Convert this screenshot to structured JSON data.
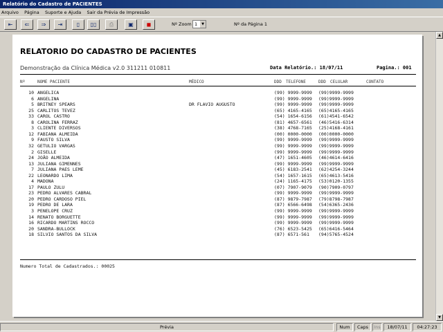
{
  "window": {
    "title": "Relatório do Cadastro de PACIENTES"
  },
  "menu": [
    "Arquivo",
    "Página",
    "Suporte e Ajuda",
    "Sair da Prévia de Impressão"
  ],
  "toolbar": {
    "buttons": [
      {
        "name": "first-page-icon",
        "glyph": "⇤"
      },
      {
        "name": "prev-page-icon",
        "glyph": "⇐"
      },
      {
        "name": "next-page-icon",
        "glyph": "⇒"
      },
      {
        "name": "last-page-icon",
        "glyph": "⇥"
      },
      {
        "name": "single-page-icon",
        "glyph": "▯"
      },
      {
        "name": "two-pages-icon",
        "glyph": "▯▯"
      },
      {
        "name": "printer-icon",
        "glyph": "⎙"
      },
      {
        "name": "setup-icon",
        "glyph": "▣"
      },
      {
        "name": "stop-icon",
        "glyph": "◼"
      }
    ],
    "zoom_label": "Nº Zoom",
    "zoom_value": "1",
    "page_label": "Nº da Página 1"
  },
  "report": {
    "title": "RELATORIO DO CADASTRO DE PACIENTES",
    "subtitle": "Demonstração da Clínica Médica v2.0 311211 010811",
    "date": "Data Relatório.: 18/07/11",
    "page": "Pagina.: 001",
    "headers": {
      "num": "Nº",
      "name": "NOME PACIENTE",
      "doctor": "MÉDICO",
      "ddd1": "DDD",
      "phone": "TELEFONE",
      "ddd2": "DDD",
      "cell": "CELULAR",
      "contact": "CONTATO"
    },
    "rows": [
      {
        "n": "10",
        "name": "ANGELICA",
        "doc": "",
        "ph": "(99) 9999-9999",
        "cel": "(99)9999-9999"
      },
      {
        "n": "6",
        "name": "ANGELINA",
        "doc": "",
        "ph": "(99) 9999-9999",
        "cel": "(99)9999-9999"
      },
      {
        "n": "5",
        "name": "BRITNEY SPEARS",
        "doc": "DR FLAVIO AUGUSTO",
        "ph": "(99) 9999-9999",
        "cel": "(99)9999-9999"
      },
      {
        "n": "25",
        "name": "CARLITOS TEVEZ",
        "doc": "",
        "ph": "(65) 4165-4165",
        "cel": "(65)4165-4165"
      },
      {
        "n": "33",
        "name": "CAROL CASTRO",
        "doc": "",
        "ph": "(54) 1654-6156",
        "cel": "(61)4541-6542"
      },
      {
        "n": "8",
        "name": "CAROLINA FERRAZ",
        "doc": "",
        "ph": "(81) 4657-6561",
        "cel": "(46)5416-6314"
      },
      {
        "n": "3",
        "name": "CLIENTE DIVERSOS",
        "doc": "",
        "ph": "(38) 4768-7165",
        "cel": "(25)4168-4161"
      },
      {
        "n": "12",
        "name": "FABIANA ALMEIDA",
        "doc": "",
        "ph": "(00) 0000-0000",
        "cel": "(00)0000-0000"
      },
      {
        "n": "9",
        "name": "FAUSTO SILVA",
        "doc": "",
        "ph": "(99) 9999-9999",
        "cel": "(99)9999-9999"
      },
      {
        "n": "32",
        "name": "GETULIO VARGAS",
        "doc": "",
        "ph": "(99) 9999-9999",
        "cel": "(99)9999-9999"
      },
      {
        "n": "2",
        "name": "GISELLE",
        "doc": "",
        "ph": "(99) 9999-9999",
        "cel": "(99)9999-9999"
      },
      {
        "n": "24",
        "name": "JOÃO ALMEIDA",
        "doc": "",
        "ph": "(47) 1651-4605",
        "cel": "(46)4614-6416"
      },
      {
        "n": "13",
        "name": "JULIANA GIMENNES",
        "doc": "",
        "ph": "(99) 9999-9999",
        "cel": "(99)9999-9999"
      },
      {
        "n": "7",
        "name": "JULIANA PAES LEME",
        "doc": "",
        "ph": "(45) 6183-2541",
        "cel": "(62)4254-3244"
      },
      {
        "n": "22",
        "name": "LEONARDO LIMA",
        "doc": "",
        "ph": "(54) 1657-1615",
        "cel": "(65)4613-5416"
      },
      {
        "n": "4",
        "name": "MADONA",
        "doc": "",
        "ph": "(24) 1165-4175",
        "cel": "(53)0120-1355"
      },
      {
        "n": "17",
        "name": "PAULO ZULU",
        "doc": "",
        "ph": "(07) 7907-9079",
        "cel": "(90)7909-0797"
      },
      {
        "n": "23",
        "name": "PEDRO ALVARES CABRAL",
        "doc": "",
        "ph": "(99) 9999-9999",
        "cel": "(99)9999-9999"
      },
      {
        "n": "20",
        "name": "PEDRO CARDOSO PIEL",
        "doc": "",
        "ph": "(87) 9879-7987",
        "cel": "(79)8798-7987"
      },
      {
        "n": "19",
        "name": "PEDRO DE LARA",
        "doc": "",
        "ph": "(87) 6566-6498",
        "cel": "(54)6365-2436"
      },
      {
        "n": "3",
        "name": "PENELOPE CRUZ",
        "doc": "",
        "ph": "(99) 9999-9999",
        "cel": "(99)9999-9999"
      },
      {
        "n": "14",
        "name": "RENATO BORGUETTE",
        "doc": "",
        "ph": "(99) 9999-9999",
        "cel": "(99)9999-9999"
      },
      {
        "n": "16",
        "name": "RICARDO MARTINS ROCCO",
        "doc": "",
        "ph": "(99) 9999-9999",
        "cel": "(99)9999-9999"
      },
      {
        "n": "20",
        "name": "SANDRA-BULLOCK",
        "doc": "",
        "ph": "(76) 6523-5425",
        "cel": "(65)6416-5464"
      },
      {
        "n": "18",
        "name": "SILVIO SANTOS DA SILVA",
        "doc": "",
        "ph": "(87) 6571-561",
        "cel": "(94)5765-4524"
      }
    ],
    "total": "Numero Total de Cadastrados.: 00025"
  },
  "status": {
    "mode": "Prévia",
    "num": "Num",
    "caps": "Caps",
    "ins": "Ins",
    "date": "18/07/11",
    "time": "04:27:23"
  }
}
